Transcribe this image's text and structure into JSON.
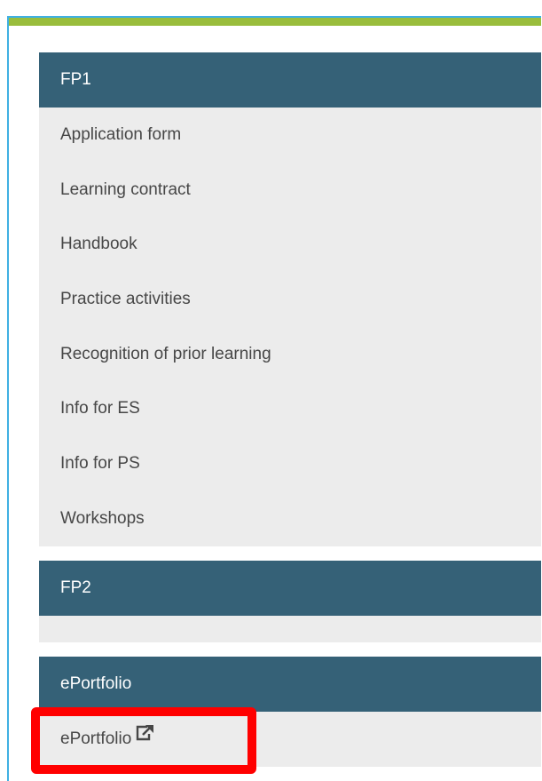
{
  "sections": {
    "fp1": {
      "title": "FP1",
      "items": [
        "Application form",
        "Learning contract",
        "Handbook",
        "Practice activities",
        "Recognition of prior learning",
        "Info for ES",
        "Info for PS",
        "Workshops"
      ]
    },
    "fp2": {
      "title": "FP2",
      "items": []
    },
    "eportfolio": {
      "title": "ePortfolio",
      "items": [
        "ePortfolio"
      ]
    }
  },
  "colors": {
    "accent_bar": "#99bd3c",
    "header_bg": "#356177",
    "body_bg": "#ececec",
    "highlight": "#ff0000",
    "frame_border": "#3fb0e3"
  },
  "icons": {
    "eportfolio_link": "external-link-icon"
  }
}
